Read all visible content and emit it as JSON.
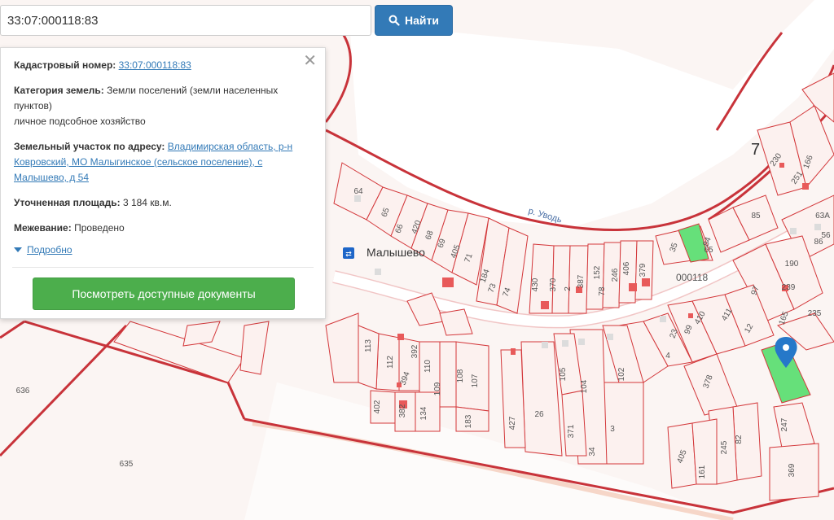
{
  "search": {
    "value": "33:07:000118:83",
    "button_label": "Найти"
  },
  "popup": {
    "cadastral_label": "Кадастровый номер:",
    "cadastral_value": "33:07:000118:83",
    "category_label": "Категория земель:",
    "category_value": "Земли поселений (земли населенных пунктов)",
    "category_use": "личное подсобное хозяйство",
    "address_label": "Земельный участок по адресу:",
    "address_value": "Владимирская область, р-н Ковровский, МО Малыгинское (сельское поселение), с Малышево, д 54",
    "area_label": "Уточненная площадь:",
    "area_value": "3 184 кв.м.",
    "survey_label": "Межевание:",
    "survey_value": "Проведено",
    "more_label": "Подробно",
    "docs_button_label": "Посмотреть доступные документы",
    "close_glyph": "✕"
  },
  "map": {
    "village_name": "Малышево",
    "river_name": "р. Уводь",
    "quarter_label": "000118",
    "big_number": "7",
    "parcel_labels": [
      "64",
      "65",
      "66",
      "420",
      "68",
      "69",
      "405",
      "71",
      "184",
      "73",
      "74",
      "430",
      "370",
      "2",
      "387",
      "152",
      "78",
      "246",
      "406",
      "379",
      "35",
      "84",
      "85",
      "65",
      "97",
      "239",
      "190",
      "165",
      "235",
      "410",
      "411",
      "12",
      "99",
      "23",
      "4",
      "378",
      "113",
      "112",
      "392",
      "110",
      "109",
      "108",
      "107",
      "394",
      "402",
      "382",
      "134",
      "183",
      "427",
      "26",
      "105",
      "104",
      "102",
      "3",
      "371",
      "34",
      "247",
      "82",
      "245",
      "405",
      "161",
      "369",
      "636",
      "635",
      "230",
      "166",
      "251",
      "63А",
      "56",
      "86"
    ],
    "colors": {
      "parcel_border": "#d3373a",
      "parcel_fill": "#fcf1ef",
      "road": "#ffffff",
      "highlight_parcel": "#66e07a",
      "marker": "#2678c9",
      "water_label": "#4a6fa5",
      "building": "#e85a5a"
    }
  },
  "icons": {
    "search": "search-icon",
    "marker": "map-marker-icon",
    "bus_stop": "bus-stop-icon"
  }
}
